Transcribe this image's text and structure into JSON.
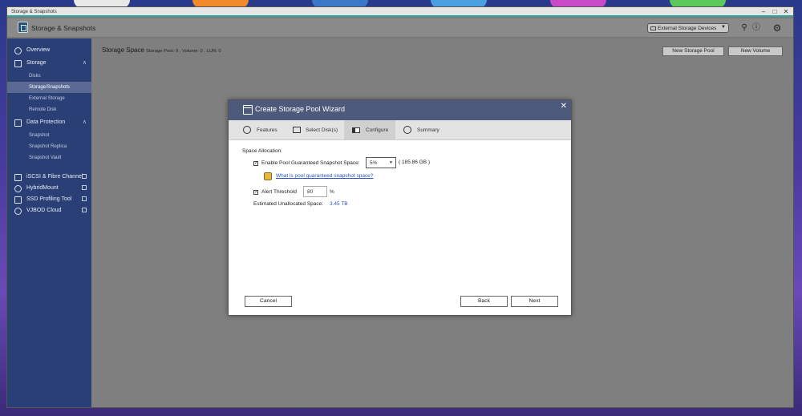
{
  "window": {
    "title": "Storage & Snapshots"
  },
  "app": {
    "title": "Storage & Snapshots",
    "external_devices": "External Storage Devices"
  },
  "sidebar": {
    "overview": "Overview",
    "storage": "Storage",
    "disks": "Disks",
    "storage_snapshots": "Storage/Snapshots",
    "external_storage": "External Storage",
    "remote_disk": "Remote Disk",
    "data_protection": "Data Protection",
    "snapshot": "Snapshot",
    "snapshot_replica": "Snapshot Replica",
    "snapshot_vault": "Snapshot Vault",
    "iscsi": "iSCSI & Fibre Channel",
    "hybridmount": "HybridMount",
    "ssd_profiling": "SSD Profiling Tool",
    "vjbod": "VJBOD Cloud"
  },
  "main": {
    "title": "Storage Space",
    "summary": "Storage Pool: 0 , Volume: 0 , LUN: 0",
    "new_pool": "New Storage Pool",
    "new_volume": "New Volume"
  },
  "dialog": {
    "title": "Create Storage Pool Wizard",
    "steps": [
      "Features",
      "Select Disk(s)",
      "Configure",
      "Summary"
    ],
    "space_allocation": "Space Allocation:",
    "enable_snapshot": "Enable Pool Guaranteed Snapshot Space:",
    "snapshot_percent": "5%",
    "snapshot_size": "( 185.86 GB )",
    "help_link": "What is pool guaranteed snapshot space?",
    "alert_threshold": "Alert Threshold",
    "alert_value": "80",
    "percent": "%",
    "unallocated_label": "Estimated Unallocated Space:",
    "unallocated_value": "3.45 TB",
    "cancel": "Cancel",
    "back": "Back",
    "next": "Next"
  },
  "colors": {
    "accent": "#2fa7a0",
    "sidebar": "#2a3f75",
    "dialog_header": "#4d5a7c",
    "link": "#2a55c0"
  }
}
